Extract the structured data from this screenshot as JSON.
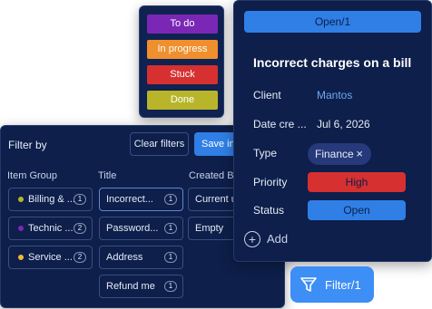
{
  "status_options": [
    {
      "label": "To do",
      "color": "#7b27b5"
    },
    {
      "label": "In progress",
      "color": "#f08f2e"
    },
    {
      "label": "Stuck",
      "color": "#d63031"
    },
    {
      "label": "Done",
      "color": "#b8b52a"
    }
  ],
  "filter_panel": {
    "title": "Filter by",
    "clear_label": "Clear filters",
    "save_label": "Save in t",
    "columns": {
      "item_group": {
        "header": "Item Group",
        "items": [
          {
            "label": "Billing & ...",
            "count": "1",
            "dot_color": "#b8b52a"
          },
          {
            "label": "Technic ...",
            "count": "2",
            "dot_color": "#7b27b5"
          },
          {
            "label": "Service ...",
            "count": "2",
            "dot_color": "#f5b82e"
          }
        ]
      },
      "title": {
        "header": "Title",
        "items": [
          {
            "label": "Incorrect...",
            "count": "1",
            "selected": true
          },
          {
            "label": "Password...",
            "count": "1"
          },
          {
            "label": "Address",
            "count": "1"
          },
          {
            "label": "Refund me",
            "count": "1"
          }
        ]
      },
      "created_by": {
        "header": "Created By",
        "items": [
          {
            "label": "Current us"
          },
          {
            "label": "Empty"
          }
        ]
      }
    }
  },
  "detail": {
    "status_button": "Open/1",
    "title": "Incorrect charges on a bill",
    "fields": {
      "client": {
        "label": "Client",
        "value": "Mantos"
      },
      "date": {
        "label": "Date cre ...",
        "value": "Jul 6, 2026"
      },
      "type": {
        "label": "Type",
        "value": "Finance",
        "remove_icon": "×"
      },
      "priority": {
        "label": "Priority",
        "value": "High",
        "color": "#d63031"
      },
      "status": {
        "label": "Status",
        "value": "Open",
        "color": "#2f7fe6"
      }
    },
    "add_icon": "+",
    "add_label": "Add"
  },
  "filter_button": {
    "label": "Filter/1",
    "icon": "filter-icon"
  }
}
